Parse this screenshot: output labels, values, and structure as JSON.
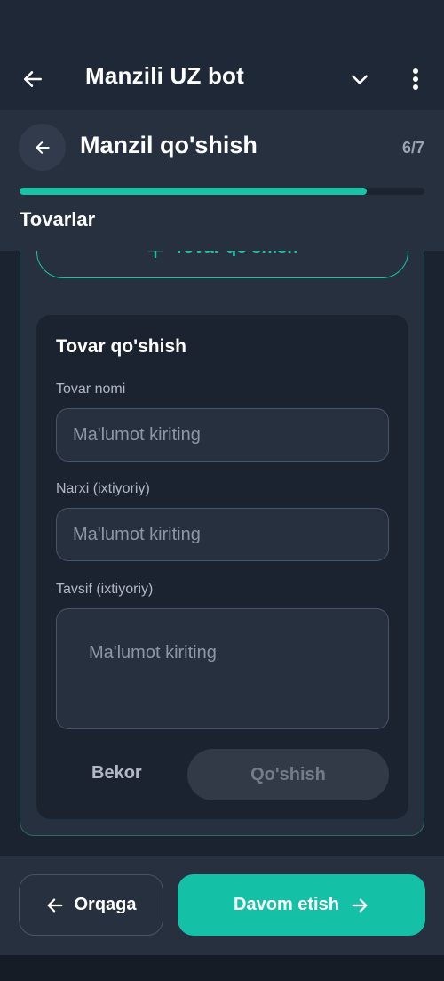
{
  "app_bar": {
    "title": "Manzili UZ bot",
    "icons": [
      "arrow-left-icon",
      "chevron-down-icon",
      "more-vertical-icon"
    ]
  },
  "header": {
    "title": "Manzil qo'shish",
    "step": "6/7",
    "progress_fraction": 0.857,
    "section_title": "Tovarlar"
  },
  "add_product_button": {
    "label": "Tovar qo'shish",
    "icon": "plus-icon"
  },
  "form": {
    "title": "Tovar qo'shish",
    "fields": [
      {
        "label": "Tovar nomi",
        "placeholder": "Ma'lumot kiriting"
      },
      {
        "label": "Narxi (ixtiyoriy)",
        "placeholder": "Ma'lumot kiriting"
      },
      {
        "label": "Tavsif (ixtiyoriy)",
        "placeholder": "Ma'lumot kiriting"
      }
    ],
    "cancel_label": "Bekor",
    "submit_label": "Qo'shish"
  },
  "footer": {
    "back_label": "Orqaga",
    "next_label": "Davom etish"
  },
  "colors": {
    "accent": "#18c3a6",
    "background": "#1b2230",
    "surface": "#27303f"
  }
}
